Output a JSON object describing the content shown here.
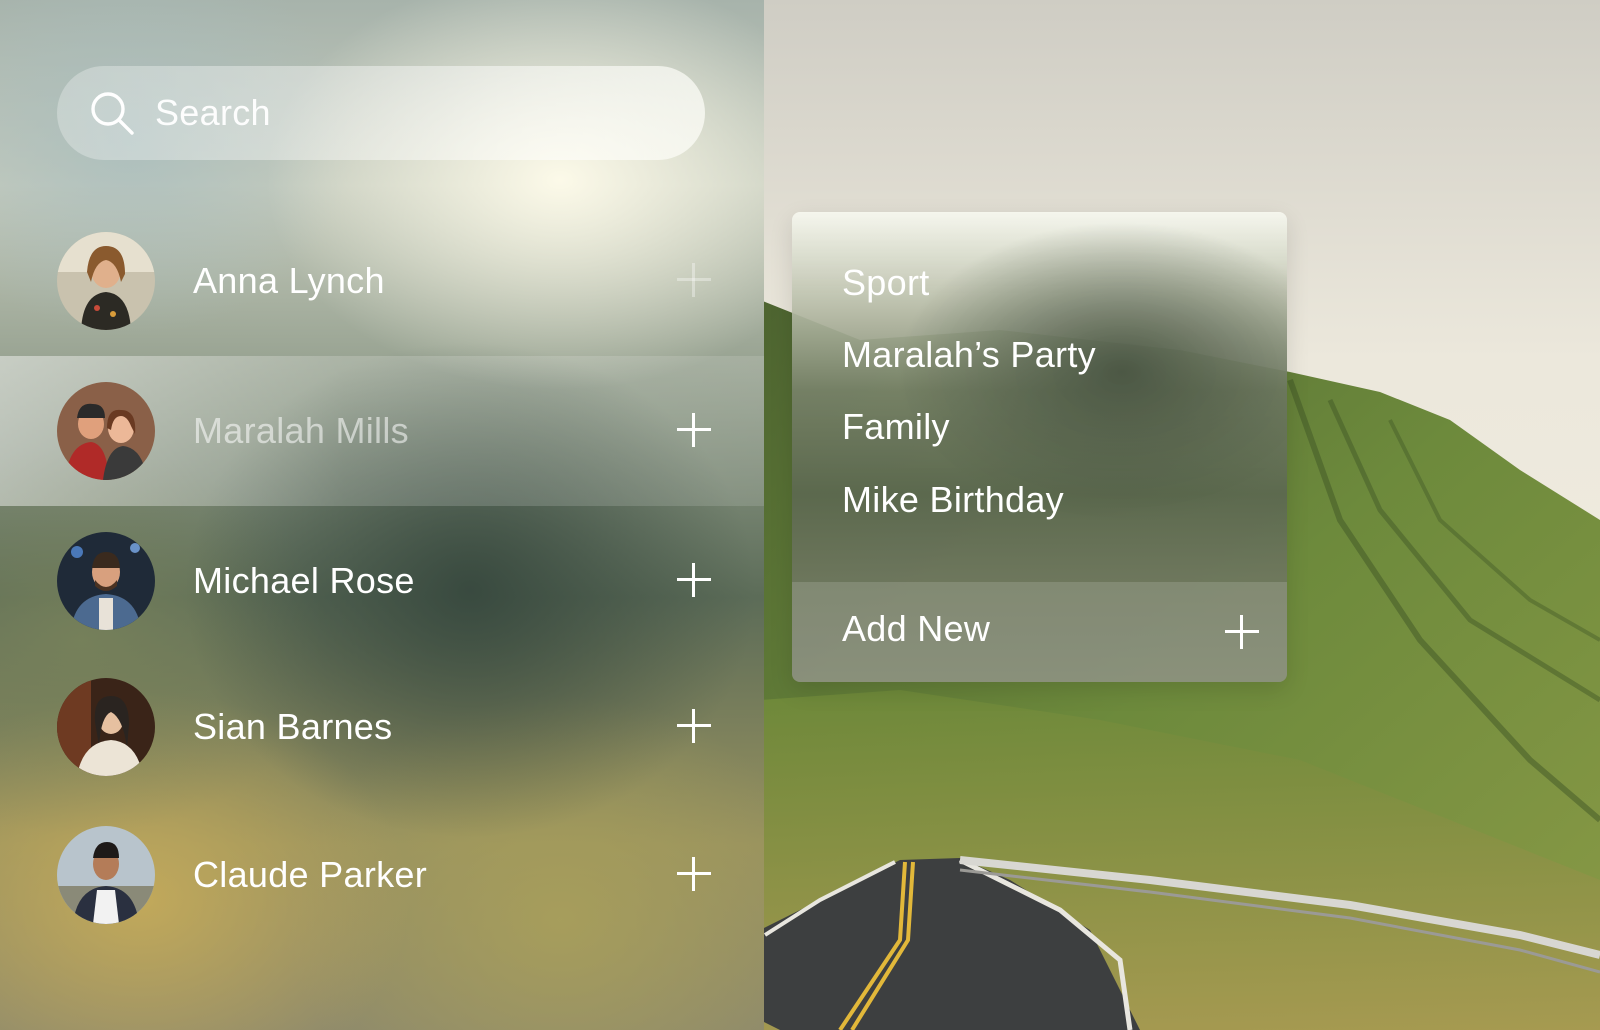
{
  "search": {
    "placeholder": "Search",
    "icon": "search-icon"
  },
  "contacts": [
    {
      "name": "Anna Lynch",
      "highlighted": false,
      "action_icon": "plus-icon"
    },
    {
      "name": "Maralah Mills",
      "highlighted": true,
      "action_icon": "plus-icon"
    },
    {
      "name": "Michael Rose",
      "highlighted": false,
      "action_icon": "plus-icon"
    },
    {
      "name": "Sian Barnes",
      "highlighted": false,
      "action_icon": "plus-icon"
    },
    {
      "name": "Claude Parker",
      "highlighted": false,
      "action_icon": "plus-icon"
    }
  ],
  "groups_menu": {
    "items": [
      "Sport",
      "Maralah’s Party",
      "Family",
      "Mike Birthday"
    ],
    "add_new_label": "Add New",
    "add_new_icon": "plus-icon"
  },
  "colors": {
    "text": "#ffffff",
    "sky": "#e9e5da",
    "mountain": "#5f7a36",
    "road": "#3d3f40",
    "road_line_yellow": "#e2b83a"
  }
}
